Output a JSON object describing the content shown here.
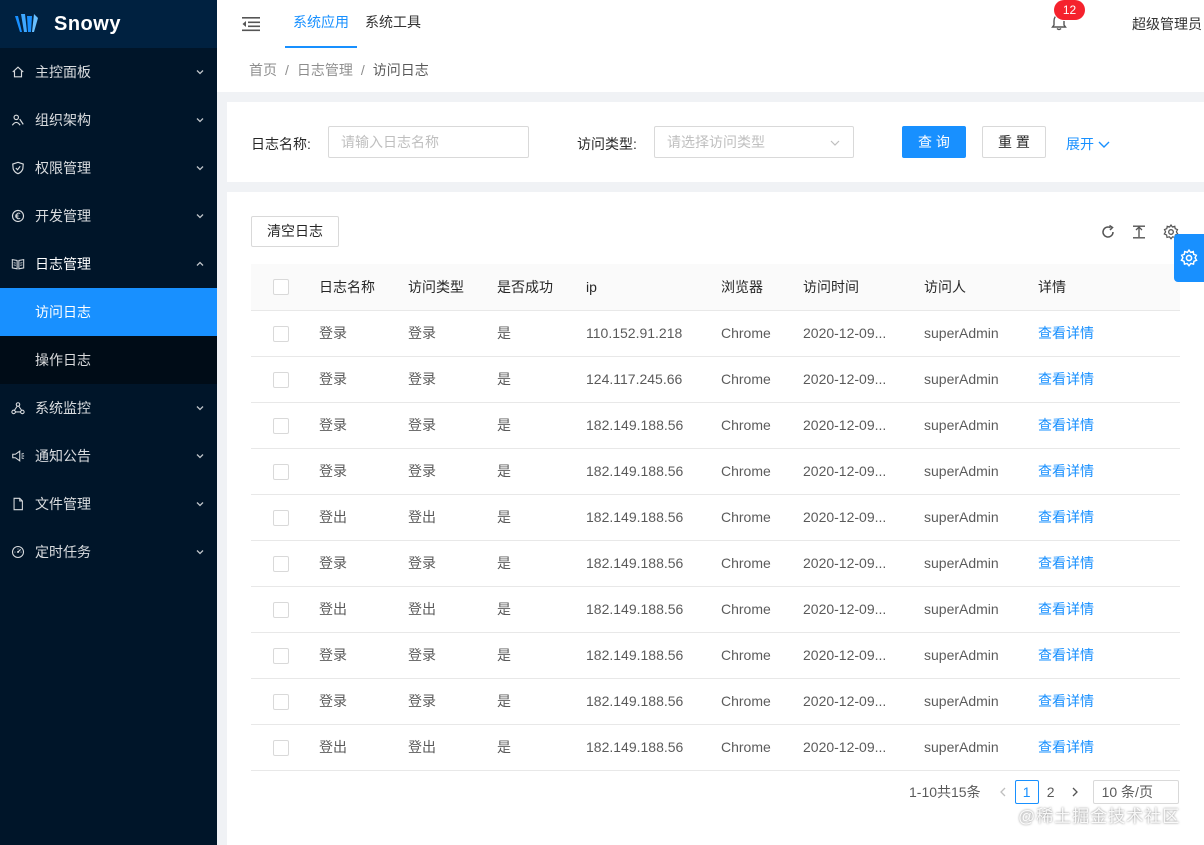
{
  "app": {
    "name": "Snowy"
  },
  "sidebar": {
    "items": [
      {
        "label": "主控面板",
        "icon": "home-icon"
      },
      {
        "label": "组织架构",
        "icon": "team-icon"
      },
      {
        "label": "权限管理",
        "icon": "shield-icon"
      },
      {
        "label": "开发管理",
        "icon": "euro-icon"
      },
      {
        "label": "日志管理",
        "icon": "log-icon",
        "open": true,
        "children": [
          {
            "label": "访问日志",
            "active": true
          },
          {
            "label": "操作日志"
          }
        ]
      },
      {
        "label": "系统监控",
        "icon": "cluster-icon"
      },
      {
        "label": "通知公告",
        "icon": "sound-icon"
      },
      {
        "label": "文件管理",
        "icon": "file-icon"
      },
      {
        "label": "定时任务",
        "icon": "dashboard-icon"
      }
    ]
  },
  "header": {
    "tabs": [
      {
        "label": "系统应用",
        "active": true
      },
      {
        "label": "系统工具"
      }
    ],
    "notification_count": "12",
    "username": "超级管理员"
  },
  "breadcrumb": [
    "首页",
    "日志管理",
    "访问日志"
  ],
  "search": {
    "name_label": "日志名称:",
    "name_placeholder": "请输入日志名称",
    "type_label": "访问类型:",
    "type_placeholder": "请选择访问类型",
    "query_button": "查 询",
    "reset_button": "重 置",
    "expand_link": "展开"
  },
  "toolbar": {
    "clear_button": "清空日志"
  },
  "table": {
    "columns": [
      "日志名称",
      "访问类型",
      "是否成功",
      "ip",
      "浏览器",
      "访问时间",
      "访问人",
      "详情"
    ],
    "rows": [
      [
        "登录",
        "登录",
        "是",
        "110.152.91.218",
        "Chrome",
        "2020-12-09...",
        "superAdmin",
        "查看详情"
      ],
      [
        "登录",
        "登录",
        "是",
        "124.117.245.66",
        "Chrome",
        "2020-12-09...",
        "superAdmin",
        "查看详情"
      ],
      [
        "登录",
        "登录",
        "是",
        "182.149.188.56",
        "Chrome",
        "2020-12-09...",
        "superAdmin",
        "查看详情"
      ],
      [
        "登录",
        "登录",
        "是",
        "182.149.188.56",
        "Chrome",
        "2020-12-09...",
        "superAdmin",
        "查看详情"
      ],
      [
        "登出",
        "登出",
        "是",
        "182.149.188.56",
        "Chrome",
        "2020-12-09...",
        "superAdmin",
        "查看详情"
      ],
      [
        "登录",
        "登录",
        "是",
        "182.149.188.56",
        "Chrome",
        "2020-12-09...",
        "superAdmin",
        "查看详情"
      ],
      [
        "登出",
        "登出",
        "是",
        "182.149.188.56",
        "Chrome",
        "2020-12-09...",
        "superAdmin",
        "查看详情"
      ],
      [
        "登录",
        "登录",
        "是",
        "182.149.188.56",
        "Chrome",
        "2020-12-09...",
        "superAdmin",
        "查看详情"
      ],
      [
        "登录",
        "登录",
        "是",
        "182.149.188.56",
        "Chrome",
        "2020-12-09...",
        "superAdmin",
        "查看详情"
      ],
      [
        "登出",
        "登出",
        "是",
        "182.149.188.56",
        "Chrome",
        "2020-12-09...",
        "superAdmin",
        "查看详情"
      ]
    ]
  },
  "pagination": {
    "total_text": "1-10共15条",
    "pages": [
      "1",
      "2"
    ],
    "current": "1",
    "page_size": "10 条/页"
  },
  "watermark": "@稀土掘金技术社区",
  "colors": {
    "primary": "#1890ff",
    "sidebar_bg": "#001529",
    "badge": "#f5222d"
  }
}
